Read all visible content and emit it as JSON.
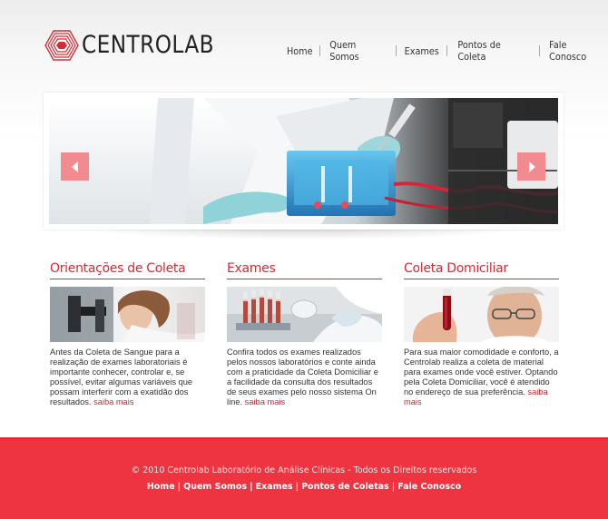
{
  "brand": {
    "name": "CENTROLAB",
    "accent": "#d62b34",
    "footer_bg": "#ee3440"
  },
  "nav": {
    "items": [
      {
        "label": "Home"
      },
      {
        "label": "Quem Somos"
      },
      {
        "label": "Exames"
      },
      {
        "label": "Pontos de Coleta"
      },
      {
        "label": "Fale Conosco"
      }
    ]
  },
  "slider": {
    "prev_icon": "chevron-left-icon",
    "next_icon": "chevron-right-icon"
  },
  "columns": [
    {
      "title": "Orientações de Coleta",
      "text": "Antes da Coleta de Sangue para a realização de exames laboratoriais é importante conhecer, controlar e, se possível, evitar algumas variáveis que possam interferir com a exatidão dos resultados.",
      "link": "saiba mais"
    },
    {
      "title": "Exames",
      "text": "Confira todos os exames realizados pelos nossos laboratórios e conte ainda com a praticidade da Coleta Domiciliar e a facilidade da consulta dos resultados de seus exames pelo nosso sistema On line.",
      "link": "saiba mais"
    },
    {
      "title": "Coleta Domiciliar",
      "text": "Para sua maior comodidade e conforto, a Centrolab realiza a coleta de material para exames onde você estiver. Optando pela Coleta Domiciliar, você é atendido no endereço de sua preferência.",
      "link": "saiba mais"
    }
  ],
  "footer": {
    "copyright": "© 2010 Centrolab Laboratório de Análise Clínicas - Todos os Direitos reservados",
    "links": [
      {
        "label": "Home"
      },
      {
        "label": "Quem Somos"
      },
      {
        "label": "Exames"
      },
      {
        "label": "Pontos de Coletas"
      },
      {
        "label": "Fale Conosco"
      }
    ],
    "separator": "|"
  }
}
